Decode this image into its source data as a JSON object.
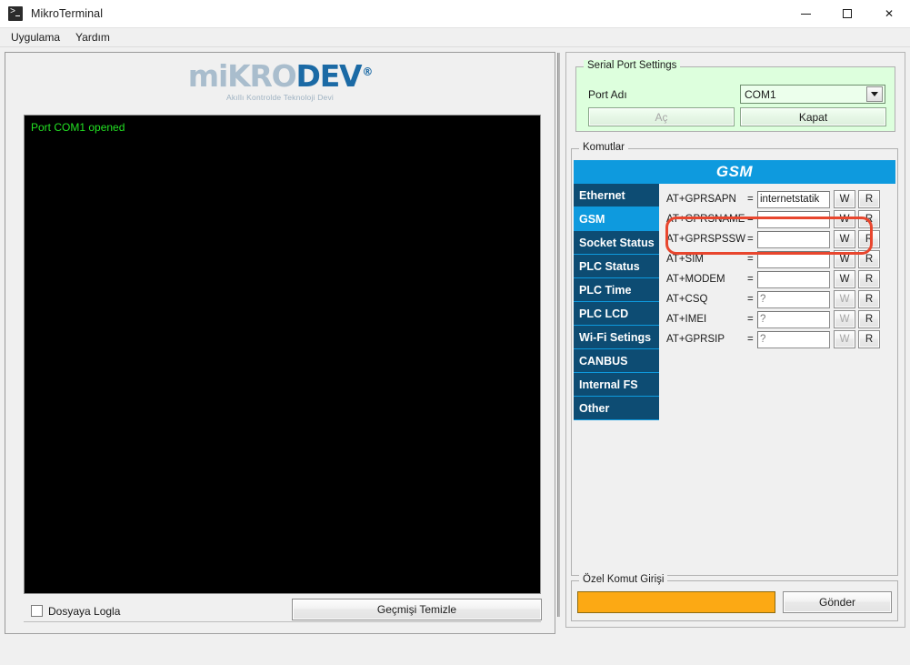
{
  "window": {
    "title": "MikroTerminal",
    "icon": "terminal-icon",
    "controls": {
      "minimize": "minimize-icon",
      "maximize": "maximize-icon",
      "close": "close-icon"
    }
  },
  "menubar": {
    "items": [
      {
        "label": "Uygulama"
      },
      {
        "label": "Yardım"
      }
    ]
  },
  "logo": {
    "part1": "miKRO",
    "part2": "DEV",
    "registered": "®",
    "tagline": "Akıllı Kontrolde Teknoloji Devi",
    "color_light": "#a9bdcd",
    "color_dark": "#1b6aa5"
  },
  "terminal": {
    "lines": [
      "Port COM1 opened"
    ],
    "text_color": "#23e023",
    "background": "#000000"
  },
  "left_bottom": {
    "log_checkbox_label": "Dosyaya Logla",
    "log_checkbox_checked": false,
    "clear_button_label": "Geçmişi Temizle"
  },
  "serial_port": {
    "group_title": "Serial Port Settings",
    "port_label": "Port Adı",
    "port_value": "COM1",
    "port_options": [
      "COM1"
    ],
    "open_button": "Aç",
    "open_button_enabled": false,
    "close_button": "Kapat",
    "panel_color": "#ddffdd"
  },
  "commands": {
    "group_title": "Komutlar",
    "header_title": "GSM",
    "header_color": "#0e9ade",
    "tab_inactive_color": "#0d4c73",
    "tabs": [
      {
        "label": "Ethernet",
        "active": false
      },
      {
        "label": "GSM",
        "active": true
      },
      {
        "label": "Socket Status",
        "active": false
      },
      {
        "label": "PLC Status",
        "active": false
      },
      {
        "label": "PLC Time",
        "active": false
      },
      {
        "label": "PLC LCD",
        "active": false
      },
      {
        "label": "Wi-Fi Setings",
        "active": false
      },
      {
        "label": "CANBUS",
        "active": false
      },
      {
        "label": "Internal FS",
        "active": false
      },
      {
        "label": "Other",
        "active": false
      }
    ],
    "write_label": "W",
    "read_label": "R",
    "equals": "=",
    "rows": [
      {
        "name": "AT+GPRSAPN",
        "value": "internetstatik",
        "placeholder": false,
        "write_enabled": true,
        "read_enabled": true
      },
      {
        "name": "AT+GPRSNAME",
        "value": "",
        "placeholder": false,
        "write_enabled": true,
        "read_enabled": true
      },
      {
        "name": "AT+GPRSPSSW",
        "value": "",
        "placeholder": false,
        "write_enabled": true,
        "read_enabled": true
      },
      {
        "name": "AT+SIM",
        "value": "",
        "placeholder": false,
        "write_enabled": true,
        "read_enabled": true
      },
      {
        "name": "AT+MODEM",
        "value": "",
        "placeholder": false,
        "write_enabled": true,
        "read_enabled": true
      },
      {
        "name": "AT+CSQ",
        "value": "?",
        "placeholder": true,
        "write_enabled": false,
        "read_enabled": true
      },
      {
        "name": "AT+IMEI",
        "value": "?",
        "placeholder": true,
        "write_enabled": false,
        "read_enabled": true
      },
      {
        "name": "AT+GPRSIP",
        "value": "?",
        "placeholder": true,
        "write_enabled": false,
        "read_enabled": true
      }
    ],
    "highlight": {
      "color": "#e8462e",
      "rows": [
        "AT+GPRSNAME",
        "AT+GPRSPSSW"
      ]
    }
  },
  "custom_command": {
    "group_title": "Özel Komut Girişi",
    "input_value": "",
    "input_color": "#fca914",
    "send_button": "Gönder"
  }
}
